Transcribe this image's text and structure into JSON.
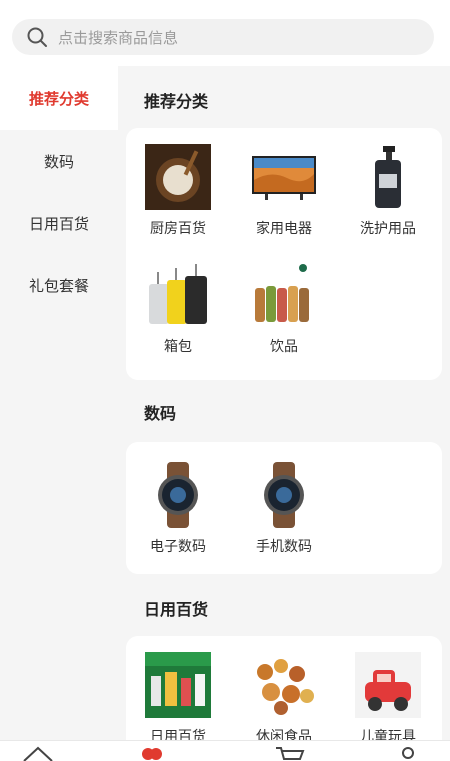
{
  "search": {
    "placeholder": "点击搜索商品信息"
  },
  "sidebar": {
    "items": [
      {
        "label": "推荐分类",
        "active": true
      },
      {
        "label": "数码",
        "active": false
      },
      {
        "label": "日用百货",
        "active": false
      },
      {
        "label": "礼包套餐",
        "active": false
      }
    ]
  },
  "sections": [
    {
      "title": "推荐分类",
      "items": [
        {
          "label": "厨房百货",
          "icon": "rice-bowl-image"
        },
        {
          "label": "家用电器",
          "icon": "tv-image"
        },
        {
          "label": "洗护用品",
          "icon": "shampoo-bottle-image"
        },
        {
          "label": "箱包",
          "icon": "luggage-image"
        },
        {
          "label": "饮品",
          "icon": "drinks-image"
        }
      ]
    },
    {
      "title": "数码",
      "items": [
        {
          "label": "电子数码",
          "icon": "smartwatch-image"
        },
        {
          "label": "手机数码",
          "icon": "smartwatch-image"
        }
      ]
    },
    {
      "title": "日用百货",
      "items": [
        {
          "label": "日用百货",
          "icon": "daily-goods-image"
        },
        {
          "label": "休闲食品",
          "icon": "snacks-image"
        },
        {
          "label": "儿童玩具",
          "icon": "toy-car-image"
        }
      ]
    }
  ],
  "colors": {
    "accent": "#e03a2f",
    "background": "#f5f5f5",
    "card": "#ffffff"
  }
}
